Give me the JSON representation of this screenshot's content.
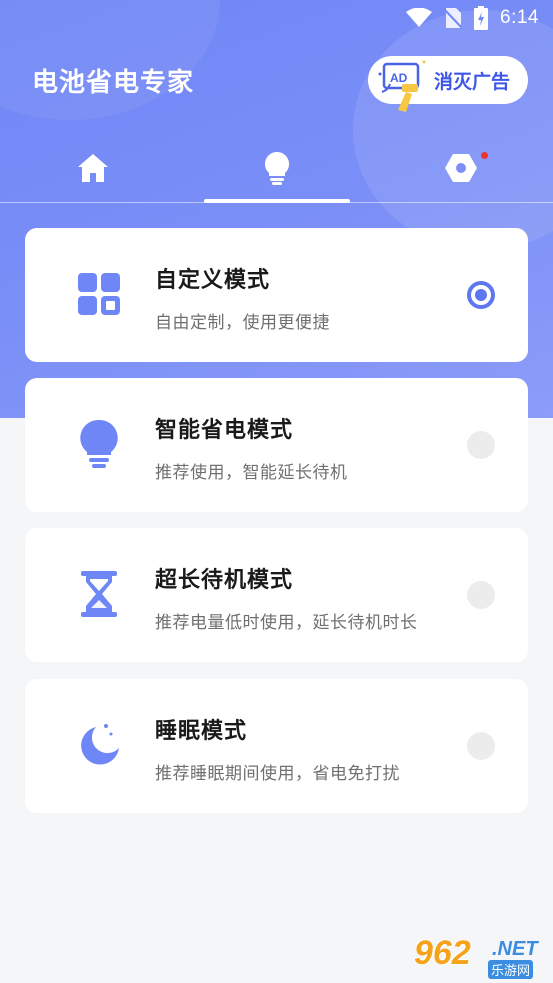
{
  "status_bar": {
    "time": "6:14",
    "icons": [
      "wifi-icon",
      "no-sim-icon",
      "battery-charging-icon"
    ]
  },
  "header": {
    "title": "电池省电专家",
    "remove_ads_label": "消灭广告",
    "ad_badge_text": "AD"
  },
  "tabs": [
    {
      "name": "home",
      "icon": "home-icon",
      "selected": false
    },
    {
      "name": "modes",
      "icon": "bulb-icon",
      "selected": true
    },
    {
      "name": "settings",
      "icon": "hexagon-settings-icon",
      "selected": false,
      "has_notification": true
    }
  ],
  "modes": [
    {
      "title": "自定义模式",
      "subtitle": "自由定制，使用更便捷",
      "icon": "grid-icon",
      "selected": true
    },
    {
      "title": "智能省电模式",
      "subtitle": "推荐使用，智能延长待机",
      "icon": "bulb-icon",
      "selected": false
    },
    {
      "title": "超长待机模式",
      "subtitle": "推荐电量低时使用，延长待机时长",
      "icon": "hourglass-icon",
      "selected": false
    },
    {
      "title": "睡眠模式",
      "subtitle": "推荐睡眠期间使用，省电免打扰",
      "icon": "moon-icon",
      "selected": false
    }
  ],
  "watermark": {
    "number": "962",
    "suffix": ".NET",
    "label": "乐游网"
  },
  "colors": {
    "accent": "#5d77f0",
    "header_bg": "#7088f6",
    "notification": "#e33333"
  }
}
